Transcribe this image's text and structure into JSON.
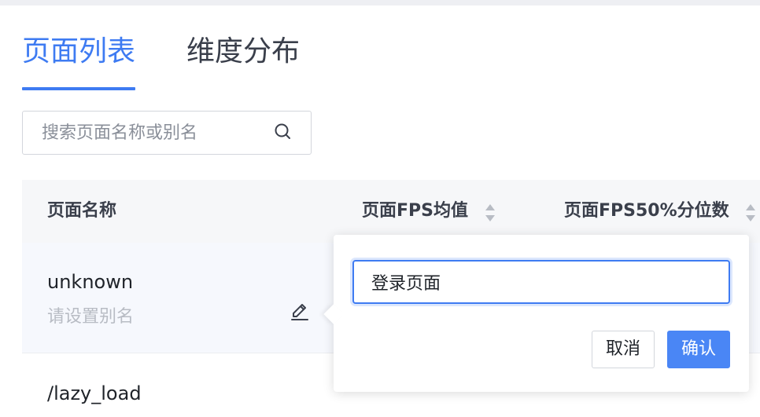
{
  "tabs": [
    {
      "label": "页面列表",
      "active": true
    },
    {
      "label": "维度分布",
      "active": false
    }
  ],
  "search": {
    "placeholder": "搜索页面名称或别名",
    "value": ""
  },
  "table": {
    "columns": [
      {
        "label": "页面名称",
        "sortable": false
      },
      {
        "label": "页面FPS均值",
        "sortable": true
      },
      {
        "label": "页面FPS50%分位数",
        "sortable": true
      }
    ],
    "rows": [
      {
        "name": "unknown",
        "alias_placeholder": "请设置别名"
      },
      {
        "name": "/lazy_load"
      }
    ]
  },
  "alias_popover": {
    "input_value": "登录页面",
    "cancel_label": "取消",
    "confirm_label": "确认"
  },
  "colors": {
    "accent": "#3e7bf2",
    "header_bg": "#f6f7f9",
    "row_hover_bg": "#f6f8fd"
  }
}
